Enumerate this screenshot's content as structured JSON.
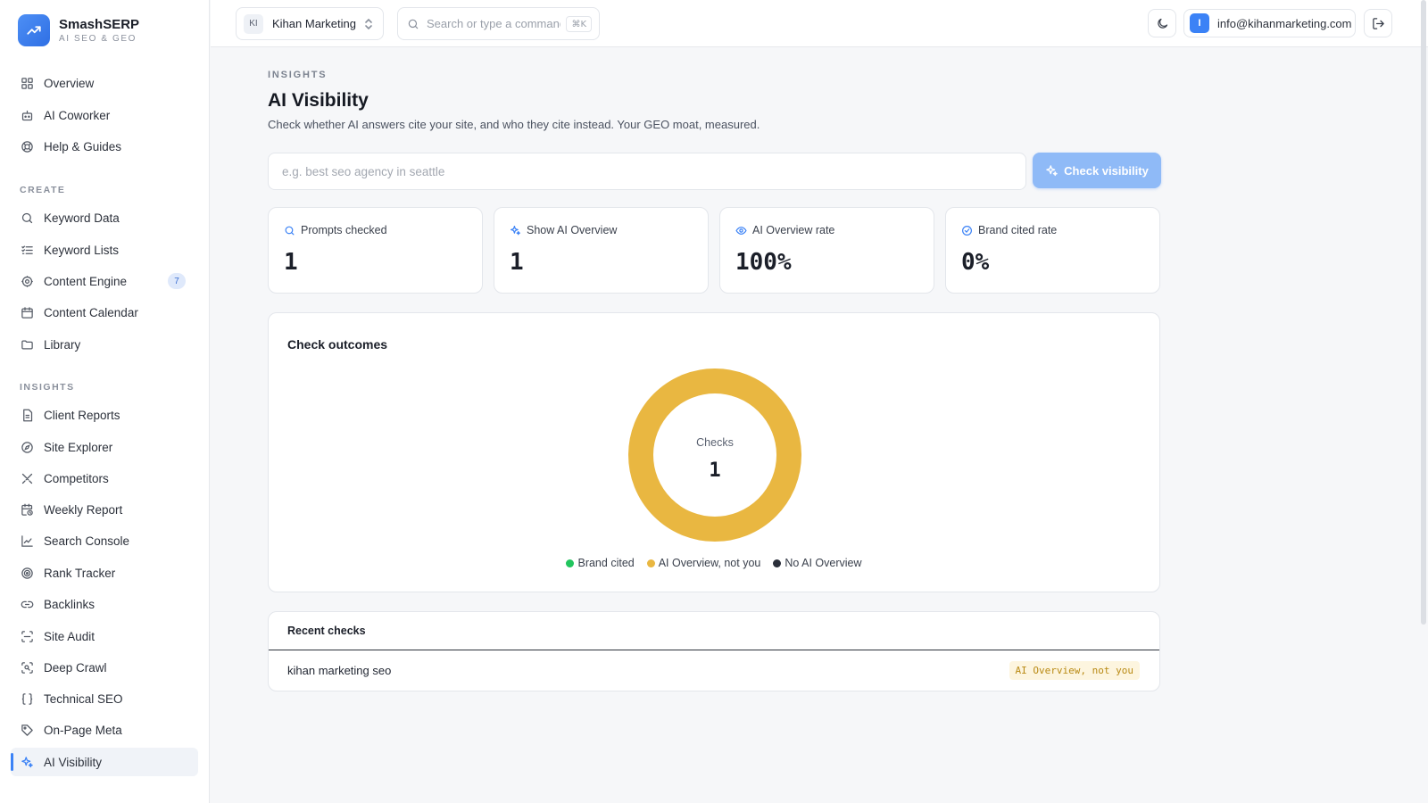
{
  "brand": {
    "name": "SmashSERP",
    "tagline": "AI SEO & GEO"
  },
  "sidebar": {
    "top_items": [
      {
        "label": "Overview",
        "icon": "grid-icon"
      },
      {
        "label": "AI Coworker",
        "icon": "bot-icon"
      },
      {
        "label": "Help & Guides",
        "icon": "lifebuoy-icon"
      }
    ],
    "create_heading": "CREATE",
    "create_items": [
      {
        "label": "Keyword Data",
        "icon": "search-icon"
      },
      {
        "label": "Keyword Lists",
        "icon": "list-icon"
      },
      {
        "label": "Content Engine",
        "icon": "engine-icon",
        "badge": "7"
      },
      {
        "label": "Content Calendar",
        "icon": "calendar-icon"
      },
      {
        "label": "Library",
        "icon": "folder-icon"
      }
    ],
    "insights_heading": "INSIGHTS",
    "insights_items": [
      {
        "label": "Client Reports",
        "icon": "file-icon"
      },
      {
        "label": "Site Explorer",
        "icon": "compass-icon"
      },
      {
        "label": "Competitors",
        "icon": "swords-icon"
      },
      {
        "label": "Weekly Report",
        "icon": "calendar-clock-icon"
      },
      {
        "label": "Search Console",
        "icon": "line-chart-icon"
      },
      {
        "label": "Rank Tracker",
        "icon": "target-icon"
      },
      {
        "label": "Backlinks",
        "icon": "link-icon"
      },
      {
        "label": "Site Audit",
        "icon": "scan-icon"
      },
      {
        "label": "Deep Crawl",
        "icon": "scan-search-icon"
      },
      {
        "label": "Technical SEO",
        "icon": "braces-icon"
      },
      {
        "label": "On-Page Meta",
        "icon": "tag-icon"
      },
      {
        "label": "AI Visibility",
        "icon": "sparkles-icon",
        "active": true
      }
    ]
  },
  "topbar": {
    "workspace": {
      "initials": "KI",
      "name": "Kihan Marketing"
    },
    "search_placeholder": "Search or type a command",
    "search_shortcut": "⌘K",
    "user": {
      "initial": "I",
      "email": "info@kihanmarketing.com"
    }
  },
  "page": {
    "eyebrow": "INSIGHTS",
    "title": "AI Visibility",
    "description": "Check whether AI answers cite your site, and who they cite instead. Your GEO moat, measured.",
    "query_placeholder": "e.g. best seo agency in seattle",
    "check_button": "Check visibility"
  },
  "stats": [
    {
      "label": "Prompts checked",
      "value": "1",
      "icon": "search-icon"
    },
    {
      "label": "Show AI Overview",
      "value": "1",
      "icon": "sparkles-icon"
    },
    {
      "label": "AI Overview rate",
      "value": "100%",
      "icon": "eye-icon"
    },
    {
      "label": "Brand cited rate",
      "value": "0%",
      "icon": "check-circle-icon"
    }
  ],
  "outcomes": {
    "title": "Check outcomes",
    "center_label": "Checks",
    "center_value": "1"
  },
  "chart_data": {
    "type": "pie",
    "title": "Check outcomes",
    "categories": [
      "Brand cited",
      "AI Overview, not you",
      "No AI Overview"
    ],
    "values": [
      0,
      1,
      0
    ],
    "colors": [
      "#22c55e",
      "#e9b741",
      "#2a2f3a"
    ],
    "legend": "bottom"
  },
  "recent": {
    "title": "Recent checks",
    "rows": [
      {
        "query": "kihan marketing seo",
        "status": "AI Overview, not you"
      }
    ]
  },
  "colors": {
    "accent": "#3b82f6",
    "donut": "#e9b741",
    "badge_bg": "#fdf5df",
    "badge_text": "#b98a14"
  }
}
